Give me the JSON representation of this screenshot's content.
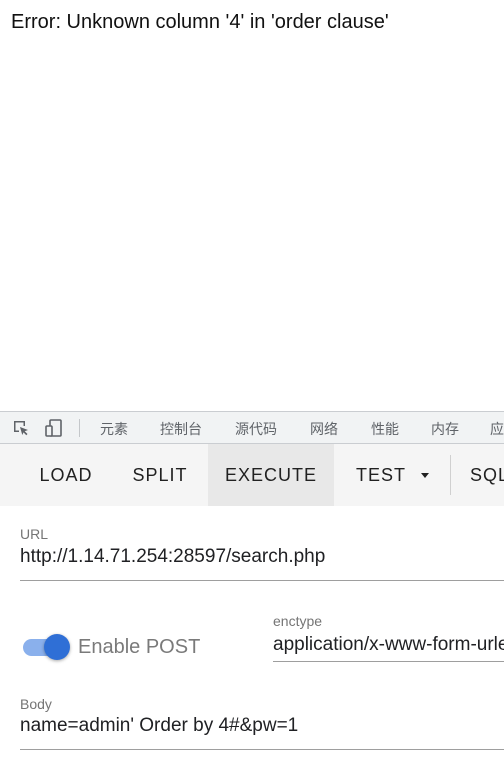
{
  "page": {
    "error_text": "Error: Unknown column '4' in 'order clause'"
  },
  "devtools": {
    "tabs": [
      "元素",
      "控制台",
      "源代码",
      "网络",
      "性能",
      "内存",
      "应"
    ],
    "icons": [
      "inspect-element-icon",
      "device-toolbar-icon"
    ]
  },
  "hackbar": {
    "buttons": [
      "LOAD",
      "SPLIT",
      "EXECUTE",
      "TEST",
      "SQL"
    ],
    "active_button": "EXECUTE",
    "url_label": "URL",
    "url_value": "http://1.14.71.254:28597/search.php",
    "enable_post_label": "Enable POST",
    "enable_post_on": true,
    "enctype_label": "enctype",
    "enctype_value": "application/x-www-form-urlencoded",
    "body_label": "Body",
    "body_value": "name=admin' Order by 4#&pw=1"
  },
  "colors": {
    "toggle_accent": "#2f6fd6",
    "toolbar_bg": "#f5f5f5"
  }
}
